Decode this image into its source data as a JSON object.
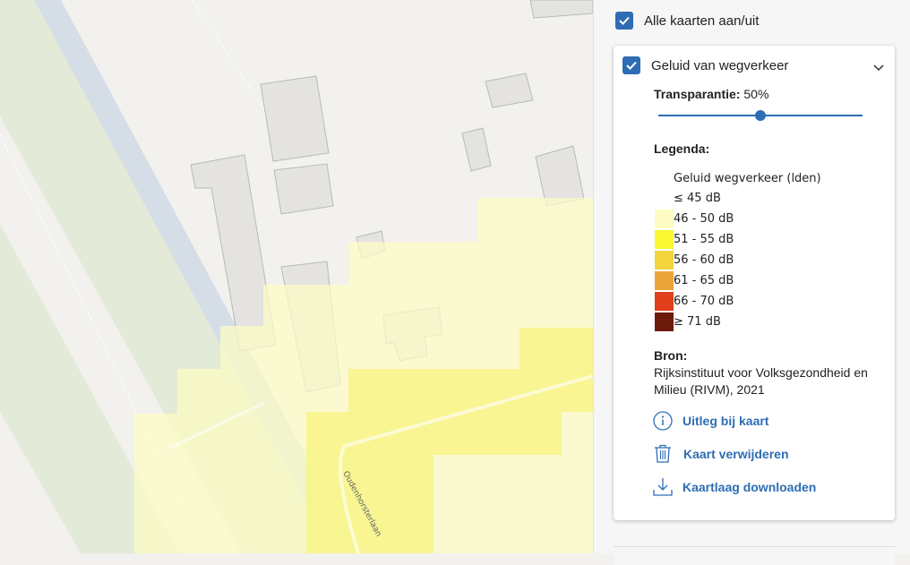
{
  "map": {
    "street_label": "Oudenhorsterlaan"
  },
  "panel": {
    "all_maps_label": "Alle kaarten aan/uit",
    "all_maps_checked": true,
    "layer": {
      "title": "Geluid van wegverkeer",
      "checked": true,
      "expanded": true,
      "transparency_label": "Transparantie:",
      "transparency_value": "50%",
      "transparency_fraction": 0.5,
      "legend_heading": "Legenda:",
      "legend_title": "Geluid wegverkeer (lden)",
      "legend_items": [
        {
          "label": "≤ 45 dB",
          "color": "#ffffff"
        },
        {
          "label": "46 - 50 dB",
          "color": "#fcfcc4"
        },
        {
          "label": "51 - 55 dB",
          "color": "#fbf833"
        },
        {
          "label": "56 - 60 dB",
          "color": "#f3d43d"
        },
        {
          "label": "61 - 65 dB",
          "color": "#eaa53a"
        },
        {
          "label": "66 - 70 dB",
          "color": "#e2401c"
        },
        {
          "label": "≥ 71 dB",
          "color": "#6c1b0c"
        }
      ],
      "source_heading": "Bron:",
      "source_text": "Rijksinstituut voor Volksgezondheid en Milieu (RIVM), 2021",
      "actions": [
        {
          "label": "Uitleg bij kaart",
          "icon": "info-icon"
        },
        {
          "label": "Kaart verwijderen",
          "icon": "trash-icon"
        },
        {
          "label": "Kaartlaag downloaden",
          "icon": "download-icon"
        }
      ]
    },
    "accent_color": "#2e6db4"
  }
}
